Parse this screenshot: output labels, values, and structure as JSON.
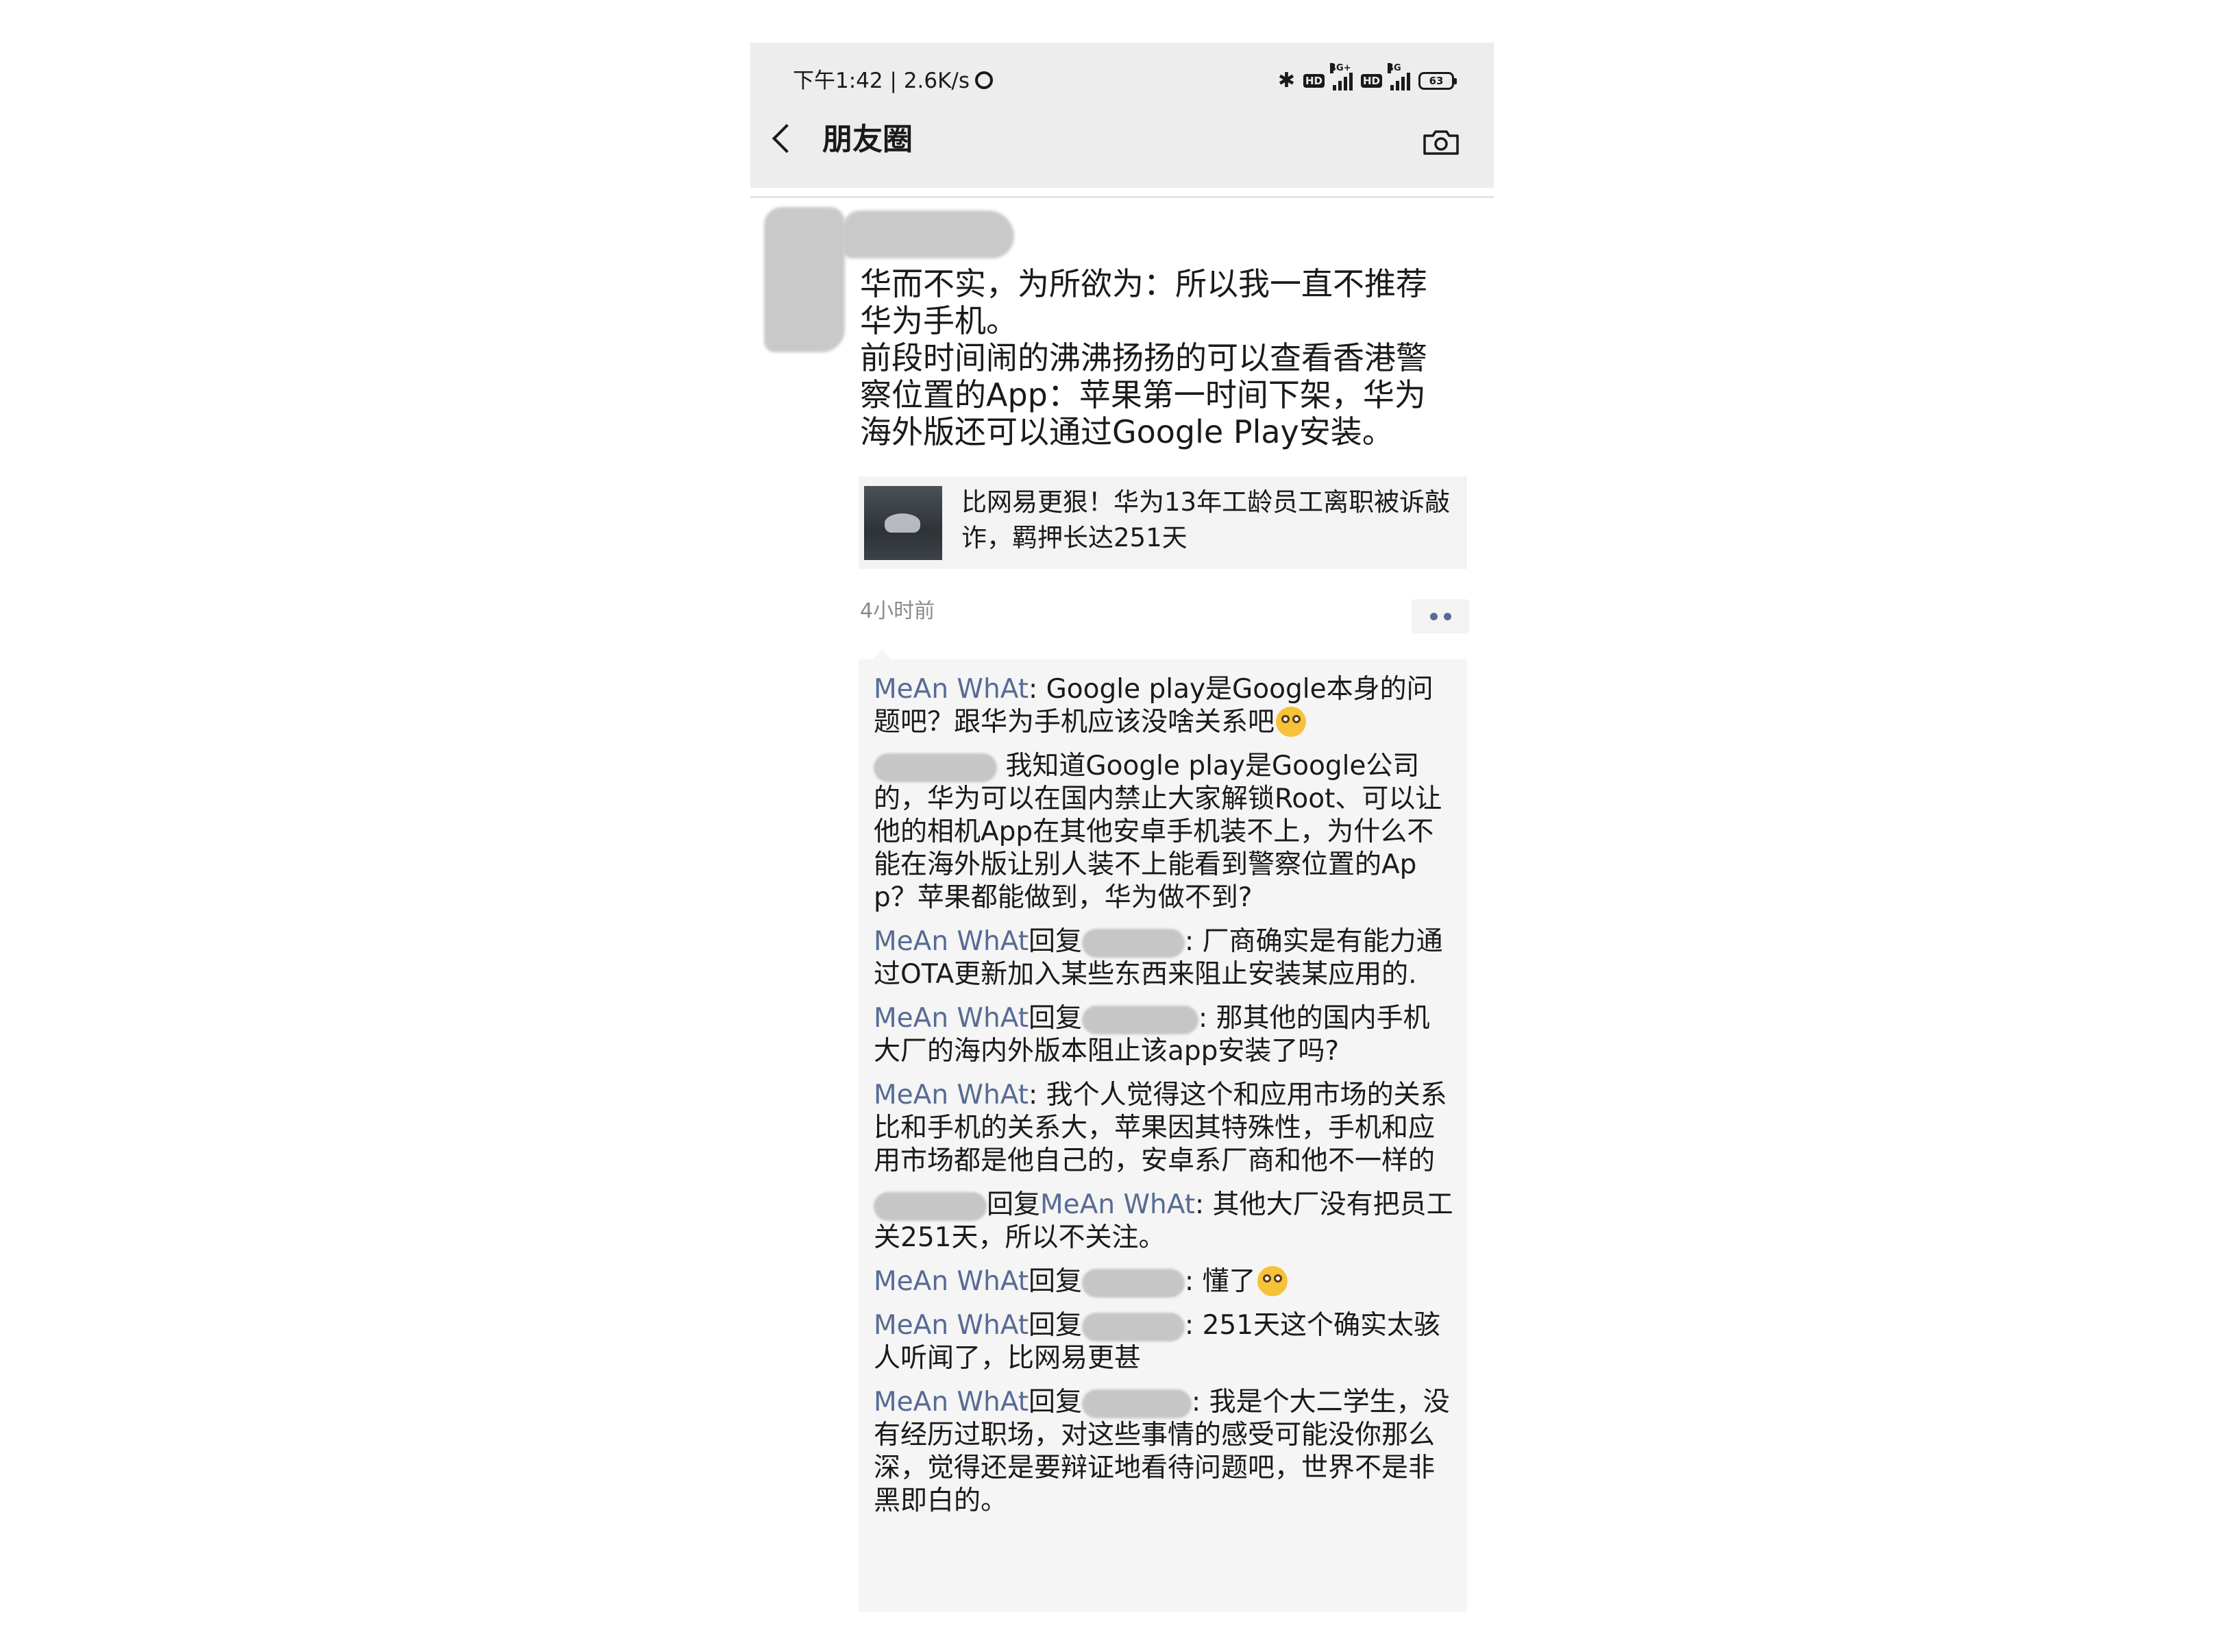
{
  "status_bar": {
    "time_speed": "下午1:42 | 2.6K/s",
    "network_1": "4G+",
    "network_2": "4G",
    "battery": "63",
    "icons": [
      "alarm-icon",
      "bluetooth-icon",
      "hd-icon",
      "signal-icon",
      "hd-icon",
      "signal-icon",
      "battery-icon"
    ]
  },
  "header": {
    "title": "朋友圈",
    "back_icon": "chevron-left-icon",
    "camera_icon": "camera-icon"
  },
  "post": {
    "text": "华而不实，为所欲为：所以我一直不推荐\n华为手机。\n前段时间闹的沸沸扬扬的可以查看香港警\n察位置的App：苹果第一时间下架，华为\n海外版还可以通过Google Play安装。",
    "link_title": "比网易更狠！华为13年工龄员工离职被诉敲诈，羁押长达251天",
    "time": "4小时前"
  },
  "comments": [
    {
      "name": "MeAn WhAt",
      "sep": ": ",
      "text": "Google play是Google本身的问题吧？跟华为手机应该没啥关系吧",
      "emoji": "flushed-emoji"
    },
    {
      "sep": " ",
      "text": "我知道Google play是Google公司的，华为可以在国内禁止大家解锁Root、可以让他的相机App在其他安卓手机装不上，为什么不能在海外版让别人装不上能看到警察位置的App？苹果都能做到，华为做不到?"
    },
    {
      "name": "MeAn WhAt",
      "reply": "回复",
      "sep": ": ",
      "text": "厂商确实是有能力通过OTA更新加入某些东西来阻止安装某应用的."
    },
    {
      "name": "MeAn WhAt",
      "reply": "回复",
      "sep": ": ",
      "text": "那其他的国内手机大厂的海内外版本阻止该app安装了吗?"
    },
    {
      "name": "MeAn WhAt",
      "sep": ": ",
      "text": "我个人觉得这个和应用市场的关系比和手机的关系大，苹果因其特殊性，手机和应用市场都是他自己的，安卓系厂商和他不一样的"
    },
    {
      "reply": "回复",
      "target": "MeAn WhAt",
      "sep": ": ",
      "text": "其他大厂没有把员工关251天，所以不关注。"
    },
    {
      "name": "MeAn WhAt",
      "reply": "回复",
      "sep": ": ",
      "text": "懂了",
      "emoji": "thinking-emoji"
    },
    {
      "name": "MeAn WhAt",
      "reply": "回复",
      "sep": ": ",
      "text": "251天这个确实太骇人听闻了，比网易更甚"
    },
    {
      "name": "MeAn WhAt",
      "reply": "回复",
      "sep": ": ",
      "text": "我是个大二学生，没有经历过职场，对这些事情的感受可能没你那么深，觉得还是要辩证地看待问题吧，世界不是非黑即白的。"
    }
  ],
  "colors": {
    "link_blue": "#576b95",
    "title_bar_bg": "#ededed",
    "comment_bg": "#f5f5f5"
  }
}
